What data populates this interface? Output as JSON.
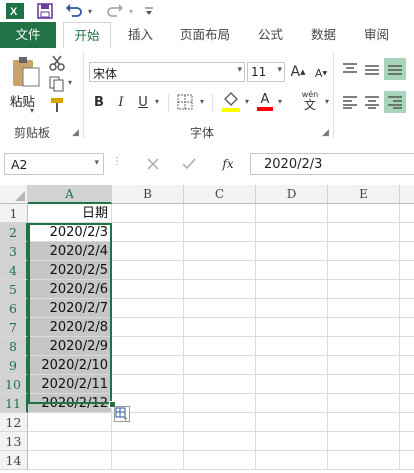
{
  "tabs": [
    "文件",
    "开始",
    "插入",
    "页面布局",
    "公式",
    "数据",
    "审阅"
  ],
  "font": {
    "name": "宋体",
    "size": "11"
  },
  "groups": {
    "clipboard": "剪贴板",
    "font": "字体"
  },
  "buttons": {
    "paste": "粘贴",
    "bold": "B",
    "italic": "I",
    "underline": "U",
    "grow": "A",
    "shrink": "A",
    "wen": "wén",
    "font_color": "A"
  },
  "namebox": "A2",
  "fx": "fx",
  "formula": "2020/2/3",
  "columns": [
    "A",
    "B",
    "C",
    "D",
    "E"
  ],
  "rows": [
    "1",
    "2",
    "3",
    "4",
    "5",
    "6",
    "7",
    "8",
    "9",
    "10",
    "11",
    "12",
    "13",
    "14"
  ],
  "cells": [
    "日期",
    "2020/2/3",
    "2020/2/4",
    "2020/2/5",
    "2020/2/6",
    "2020/2/7",
    "2020/2/8",
    "2020/2/9",
    "2020/2/10",
    "2020/2/11",
    "2020/2/12"
  ],
  "colors": {
    "accent": "#217346",
    "selection": "#c6c6c6",
    "highlight_fill": "#ffff00",
    "font_color": "#ff0000"
  },
  "icons": [
    "excel-icon",
    "save-icon",
    "undo-icon",
    "redo-icon",
    "customize-icon",
    "scissors-icon",
    "copy-icon",
    "format-painter-icon",
    "border-icon",
    "fill-color-icon",
    "align-icon",
    "cancel-icon",
    "enter-icon",
    "quick-analysis-icon"
  ]
}
